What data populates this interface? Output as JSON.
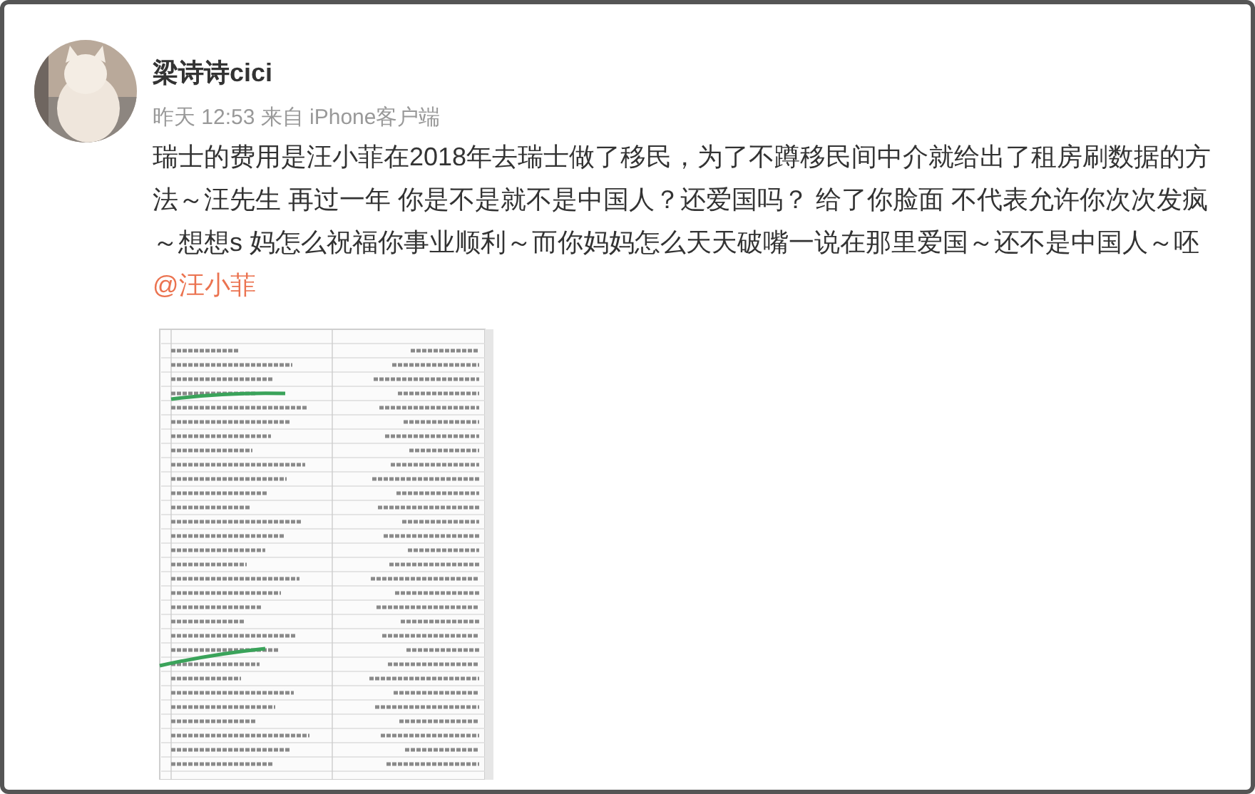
{
  "post": {
    "author": "梁诗诗cici",
    "meta": "昨天 12:53 来自 iPhone客户端",
    "text": "瑞士的费用是汪小菲在2018年去瑞士做了移民，为了不蹲移民间中介就给出了租房刷数据的方法～汪先生 再过一年 你是不是就不是中国人？还爱国吗？  给了你脸面 不代表允许你次次发疯～想想s 妈怎么祝福你事业顺利～而你妈妈怎么天天破嘴一说在那里爱国～还不是中国人～呸",
    "mention": "@汪小菲"
  }
}
